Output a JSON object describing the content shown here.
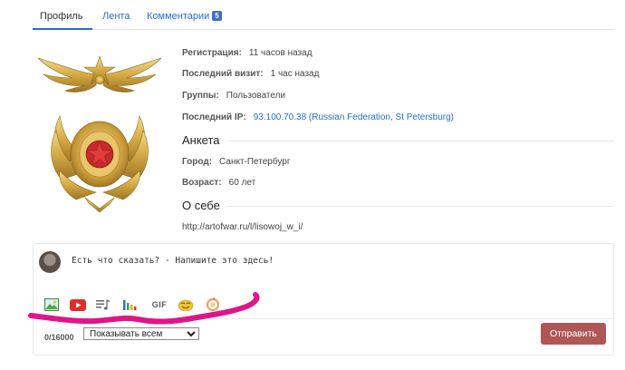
{
  "tabs": [
    {
      "label": "Профиль",
      "active": true
    },
    {
      "label": "Лента",
      "active": false
    },
    {
      "label": "Комментарии",
      "active": false,
      "badge": "5"
    }
  ],
  "profile": {
    "registration": {
      "label": "Регистрация:",
      "value": "11 часов назад"
    },
    "last_visit": {
      "label": "Последний визит:",
      "value": "1 час назад"
    },
    "groups": {
      "label": "Группы:",
      "value": "Пользователи"
    },
    "last_ip": {
      "label": "Последний IP:",
      "value": "93.100.70.38 (Russian Federation, St Petersburg)"
    }
  },
  "questionnaire": {
    "title": "Анкета",
    "city": {
      "label": "Город:",
      "value": "Санкт-Петербург"
    },
    "age": {
      "label": "Возраст:",
      "value": "60 лет"
    }
  },
  "about": {
    "title": "О себе",
    "text": "http://artofwar.ru/l/lisowoj_w_i/"
  },
  "composer": {
    "prompt": "Есть что сказать? - Напишите это здесь!",
    "toolbar_icons": [
      "image-icon",
      "youtube-icon",
      "music-playlist-icon",
      "chart-bars-icon",
      "gif-icon",
      "emoji-icon",
      "sticker-icon"
    ],
    "gif_label": "GIF",
    "counter": "0/16000",
    "visibility_selected": "Показывать всем",
    "submit_label": "Отправить"
  },
  "colors": {
    "link": "#2a6cc8",
    "badge": "#3f6fc4",
    "submit": "#b05656",
    "annotation": "#e0158a"
  }
}
